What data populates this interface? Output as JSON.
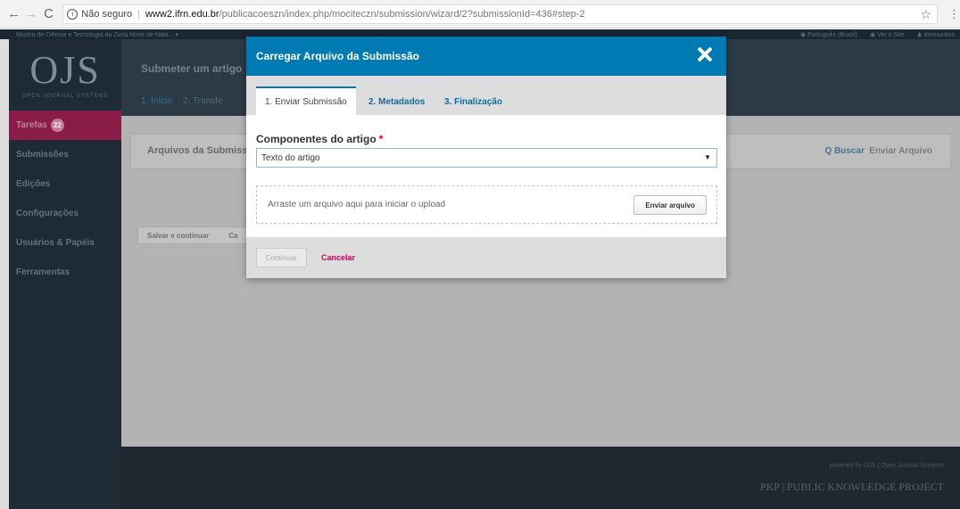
{
  "browser": {
    "back": "←",
    "forward": "→",
    "reload": "C",
    "info_icon": "i",
    "security": "Não seguro",
    "url_host": "www2.ifrn.edu.br",
    "url_path": "/publicacoeszn/index.php/mociteczn/submission/wizard/2?submissionId=436#step-2",
    "star": "☆",
    "menu": "⋮"
  },
  "topbar": {
    "site_name": "Mostra de Ciência e Tecnologia da Zona Norte de Nata... ▾",
    "language": "◉ Português (Brasil)",
    "view_site": "◉ Ver o Site",
    "user": "♟ domiuralos"
  },
  "sidebar": {
    "logo_mark": "OJS",
    "logo_sub": "OPEN JOURNAL SYSTEMS",
    "items": [
      {
        "label": "Tarefas",
        "badge": "22",
        "active": true
      },
      {
        "label": "Submissões"
      },
      {
        "label": "Edições"
      },
      {
        "label": "Configurações"
      },
      {
        "label": "Usuários & Papéis"
      },
      {
        "label": "Ferramentas"
      }
    ]
  },
  "header": {
    "title": "Submeter um artigo",
    "tabs": [
      "1. Início",
      "2. Transfe"
    ]
  },
  "content": {
    "panel_title": "Arquivos da Submiss",
    "search": "Q Buscar",
    "upload_file": "Enviar Arquivo",
    "save_continue": "Salvar e continuar",
    "cancel_partial": "Ca"
  },
  "footer": {
    "powered": "powered by OJS | Open Journal Systems",
    "pkp": "PKP | PUBLIC KNOWLEDGE PROJECT"
  },
  "modal": {
    "title": "Carregar Arquivo da Submissão",
    "tabs": [
      "1. Enviar Submissão",
      "2. Metadados",
      "3. Finalização"
    ],
    "component_label": "Componentes do artigo",
    "required_mark": "*",
    "component_value": "Texto do artigo",
    "select_arrow": "▼",
    "dropzone_text": "Arraste um arquivo aqui para iniciar o upload",
    "upload_button": "Enviar arquivo",
    "continue_button": "Continuar",
    "cancel_link": "Cancelar",
    "colors": {
      "header": "#007ab2",
      "cancel": "#d0005f",
      "required": "#dd0000"
    }
  }
}
